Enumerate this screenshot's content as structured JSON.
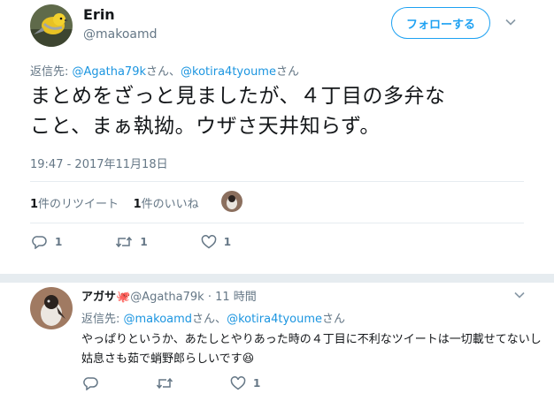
{
  "main_tweet": {
    "display_name": "Erin",
    "handle": "@makoamd",
    "follow_label": "フォローする",
    "reply_prefix": "返信先: ",
    "reply_user1": "@Agatha79k",
    "reply_joiner": "さん、",
    "reply_user2": "@kotira4tyoume",
    "reply_suffix": "さん",
    "text_line1": "まとめをざっと見ましたが、４丁目の多弁な",
    "text_line2": "こと、まぁ執拗。ウザさ天井知らず。",
    "timestamp": "19:47 - 2017年11月18日",
    "retweet_count": "1",
    "retweet_label": "件のリツイート",
    "like_count": "1",
    "like_label": "件のいいね",
    "actions": {
      "reply_count": "1",
      "retweet_count": "1",
      "like_count": "1"
    }
  },
  "reply_tweet": {
    "display_name": "アガサ",
    "emoji": "🐙",
    "handle": "@Agatha79k",
    "separator": " · ",
    "time": "11 時間",
    "reply_prefix": "返信先: ",
    "reply_user1": "@makoamd",
    "reply_joiner": "さん、",
    "reply_user2": "@kotira4tyoume",
    "reply_suffix": "さん",
    "text": "やっぱりというか、あたしとやりあった時の４丁目に不利なツイートは一切載せてないし姑息さも茹で蛸野郎らしいです😆",
    "actions": {
      "like_count": "1"
    }
  },
  "colors": {
    "accent": "#1da1f2",
    "link": "#1b95e0",
    "muted": "#657786",
    "divider": "#e6ecf0"
  },
  "icons": [
    "reply-icon",
    "retweet-icon",
    "like-icon",
    "chevron-down-icon"
  ]
}
